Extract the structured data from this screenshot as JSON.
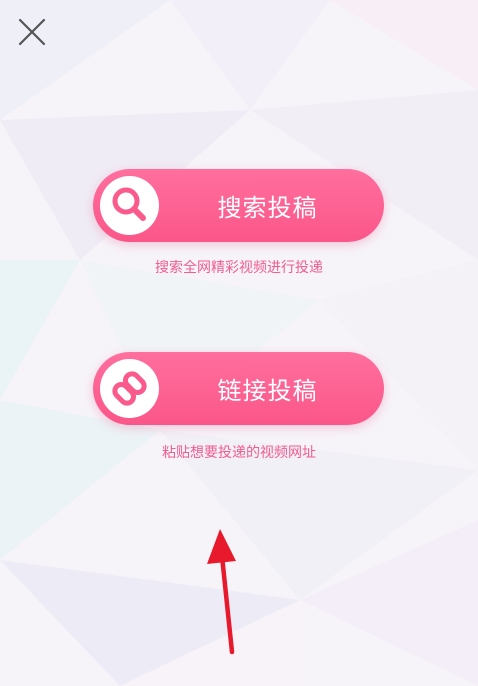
{
  "header": {
    "close_icon": "close-icon"
  },
  "search_submit": {
    "label": "搜索投稿",
    "description": "搜索全网精彩视频进行投递",
    "icon": "search-icon"
  },
  "link_submit": {
    "label": "链接投稿",
    "description": "粘贴想要投递的视频网址",
    "icon": "link-icon"
  },
  "colors": {
    "accent": "#fb5a8c",
    "caption": "#f25c8f",
    "annotation_arrow": "#e8192c",
    "close_icon": "#555555"
  }
}
